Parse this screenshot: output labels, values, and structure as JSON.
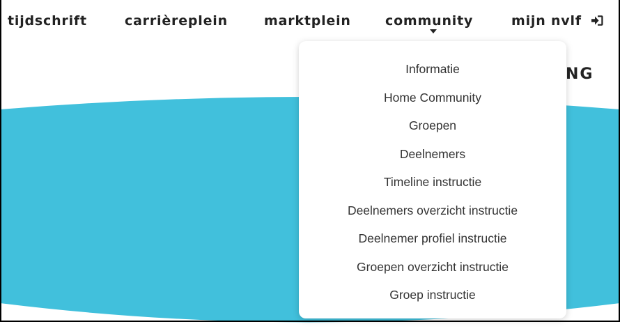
{
  "nav": {
    "items": [
      {
        "label": "tijdschrift"
      },
      {
        "label": "carrièreplein"
      },
      {
        "label": "marktplein"
      },
      {
        "label": "community"
      },
      {
        "label": "mijn nvlf"
      }
    ]
  },
  "header": {
    "title_fragment": "NG"
  },
  "dropdown": {
    "items": [
      {
        "label": "Informatie"
      },
      {
        "label": "Home Community"
      },
      {
        "label": "Groepen"
      },
      {
        "label": "Deelnemers"
      },
      {
        "label": "Timeline instructie"
      },
      {
        "label": "Deelnemers overzicht instructie"
      },
      {
        "label": "Deelnemer profiel instructie"
      },
      {
        "label": "Groepen overzicht instructie"
      },
      {
        "label": "Groep instructie"
      }
    ]
  },
  "colors": {
    "hero": "#41c0dc",
    "text": "#222222",
    "background": "#ffffff"
  },
  "icons": {
    "login": "sign-in-icon",
    "caret": "caret-down-icon"
  }
}
